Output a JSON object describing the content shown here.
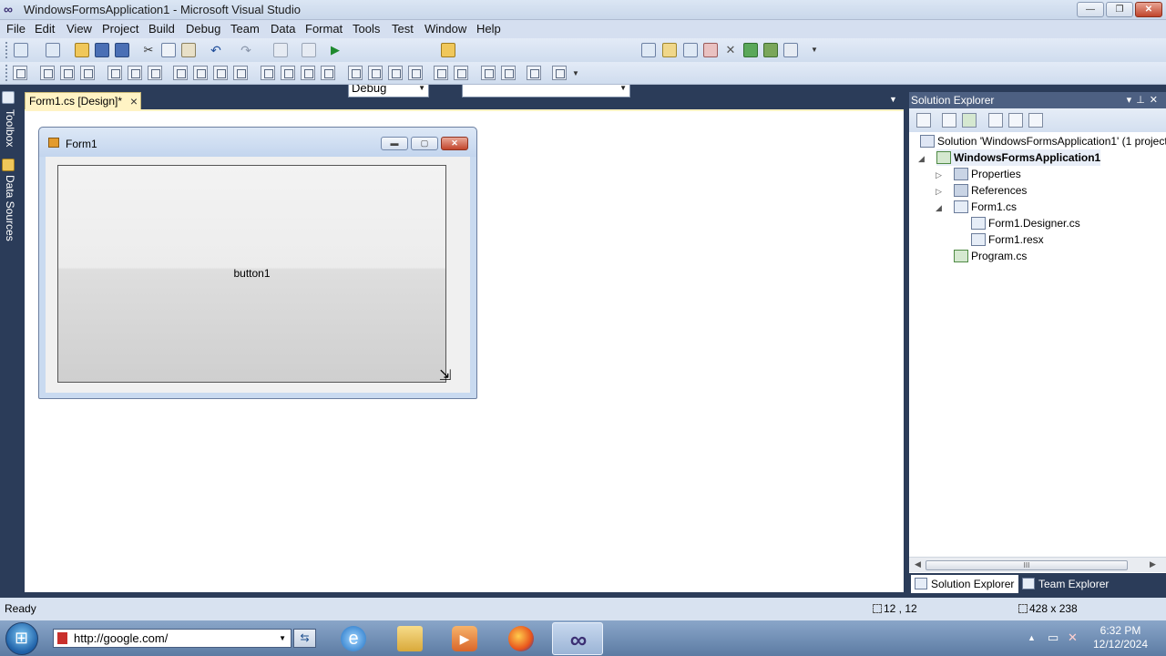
{
  "window": {
    "title": "WindowsFormsApplication1 - Microsoft Visual Studio"
  },
  "menu": [
    "File",
    "Edit",
    "View",
    "Project",
    "Build",
    "Debug",
    "Team",
    "Data",
    "Format",
    "Tools",
    "Test",
    "Window",
    "Help"
  ],
  "toolbar": {
    "config_value": "Debug",
    "platform_value": ""
  },
  "left_dock": {
    "toolbox": "Toolbox",
    "data_sources": "Data Sources"
  },
  "document_tab": {
    "label": "Form1.cs [Design]*"
  },
  "form": {
    "title": "Form1",
    "button_text": "button1"
  },
  "solution_explorer": {
    "title": "Solution Explorer",
    "tree": [
      {
        "label": "Solution 'WindowsFormsApplication1' (1 project)",
        "icon": "solution-icon"
      },
      {
        "label": "WindowsFormsApplication1",
        "icon": "csharp-project-icon",
        "bold": true,
        "expanded": true
      },
      {
        "label": "Properties",
        "icon": "properties-folder-icon",
        "expandable": true
      },
      {
        "label": "References",
        "icon": "references-icon",
        "expandable": true
      },
      {
        "label": "Form1.cs",
        "icon": "form-icon",
        "expanded": true
      },
      {
        "label": "Form1.Designer.cs",
        "icon": "cs-file-icon"
      },
      {
        "label": "Form1.resx",
        "icon": "resx-file-icon"
      },
      {
        "label": "Program.cs",
        "icon": "cs-file-icon"
      }
    ],
    "tabs": [
      "Solution Explorer",
      "Team Explorer"
    ],
    "scroll_thumb": "III"
  },
  "status": {
    "text": "Ready",
    "position": "12 , 12",
    "size": "428 x 238"
  },
  "taskbar": {
    "address": "http://google.com/",
    "time": "6:32 PM",
    "date": "12/12/2024",
    "apps": [
      "internet-explorer-icon",
      "file-explorer-icon",
      "media-player-icon",
      "firefox-icon",
      "visual-studio-icon"
    ]
  },
  "colors": {
    "accent": "#2b3c59",
    "tab_active": "#fff3c4",
    "close_red": "#c0442b"
  }
}
